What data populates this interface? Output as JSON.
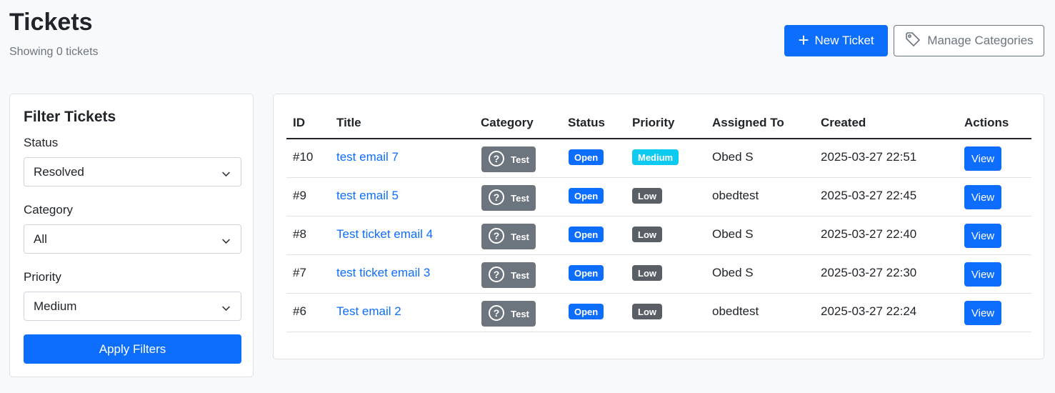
{
  "header": {
    "title": "Tickets",
    "subtitle": "Showing 0 tickets",
    "new_ticket_label": "New Ticket",
    "manage_categories_label": "Manage Categories"
  },
  "filters": {
    "title": "Filter Tickets",
    "status_label": "Status",
    "status_value": "Resolved",
    "category_label": "Category",
    "category_value": "All",
    "priority_label": "Priority",
    "priority_value": "Medium",
    "apply_label": "Apply Filters"
  },
  "table": {
    "columns": [
      "ID",
      "Title",
      "Category",
      "Status",
      "Priority",
      "Assigned To",
      "Created",
      "Actions"
    ],
    "rows": [
      {
        "id": "#10",
        "title": "test email 7",
        "category": "Test",
        "status": "Open",
        "priority": "Medium",
        "assigned": "Obed S",
        "created": "2025-03-27 22:51",
        "action": "View"
      },
      {
        "id": "#9",
        "title": "test email 5",
        "category": "Test",
        "status": "Open",
        "priority": "Low",
        "assigned": "obedtest",
        "created": "2025-03-27 22:45",
        "action": "View"
      },
      {
        "id": "#8",
        "title": "Test ticket email 4",
        "category": "Test",
        "status": "Open",
        "priority": "Low",
        "assigned": "Obed S",
        "created": "2025-03-27 22:40",
        "action": "View"
      },
      {
        "id": "#7",
        "title": "test ticket email 3",
        "category": "Test",
        "status": "Open",
        "priority": "Low",
        "assigned": "Obed S",
        "created": "2025-03-27 22:30",
        "action": "View"
      },
      {
        "id": "#6",
        "title": "Test email 2",
        "category": "Test",
        "status": "Open",
        "priority": "Low",
        "assigned": "obedtest",
        "created": "2025-03-27 22:24",
        "action": "View"
      }
    ]
  },
  "colors": {
    "primary": "#0d6efd",
    "secondary": "#6c757d",
    "info": "#0dcaf0",
    "dark_badge": "#595f65"
  },
  "icons": {
    "new_ticket": "plus-icon",
    "manage_categories": "tag-icon",
    "category": "question-circle-icon",
    "select": "chevron-down-icon"
  }
}
